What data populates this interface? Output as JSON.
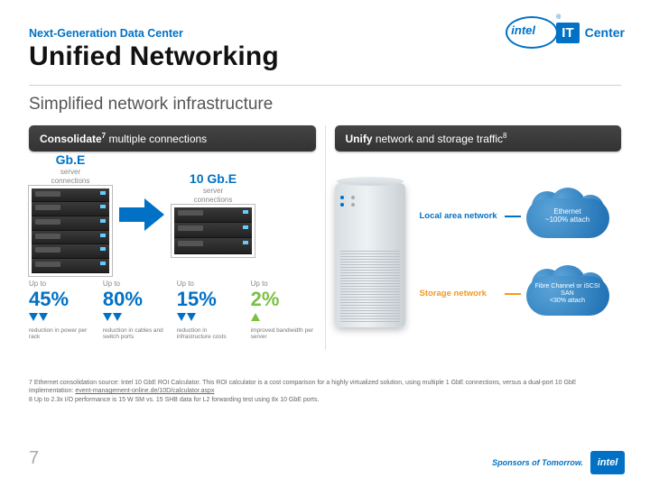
{
  "header": {
    "eyebrow": "Next-Generation Data Center",
    "title": "Unified Networking",
    "subtitle": "Simplified network infrastructure",
    "logo_brand": "intel",
    "logo_it": "IT",
    "logo_center": "Center"
  },
  "columns": {
    "left": {
      "pill_bold": "Consolidate",
      "pill_sup": "7",
      "pill_rest": " multiple connections",
      "gbe_a_big": "Gb.E",
      "gbe_a_sub": "server\nconnections",
      "gbe_b_big": "10 Gb.E",
      "gbe_b_sub": "server\nconnections",
      "stats": [
        {
          "upto": "Up to",
          "value": "45%",
          "dir": "down",
          "desc": "reduction in power per rack"
        },
        {
          "upto": "Up to",
          "value": "80%",
          "dir": "down",
          "desc": "reduction in cables and switch ports"
        },
        {
          "upto": "Up to",
          "value": "15%",
          "dir": "down",
          "desc": "reduction in infrastructure costs"
        },
        {
          "upto": "Up to",
          "value": "2%",
          "dir": "up",
          "desc": "improved bandwidth per server"
        }
      ]
    },
    "right": {
      "pill_bold": "Unify",
      "pill_rest": " network and storage traffic",
      "pill_sup": "8",
      "net_label_a": "Local area network",
      "net_label_b": "Storage network",
      "cloud_a": "Ethernet\n~100% attach",
      "cloud_b": "Fibre Channel or iSCSI SAN\n<30% attach"
    }
  },
  "footnotes": {
    "f7_num": "7",
    "f7_text": "Ethernet consolidation source: Intel 10 GbE ROI Calculator. This ROI calculator is a cost comparison for a highly virtualized solution, using multiple 1 GbE connections, versus a dual-port 10 GbE implementation: ",
    "f7_link": "event-management-online.de/10D/calculator.aspx",
    "f8_num": "8",
    "f8_text": "Up to 2.3x I/O performance is 15 W SM vs. 15 SHB data for L2 forwarding test using 8x 10 GbE ports."
  },
  "page_number": "7",
  "footer": {
    "sponsor_text": "Sponsors of Tomorrow.",
    "brand": "intel"
  }
}
